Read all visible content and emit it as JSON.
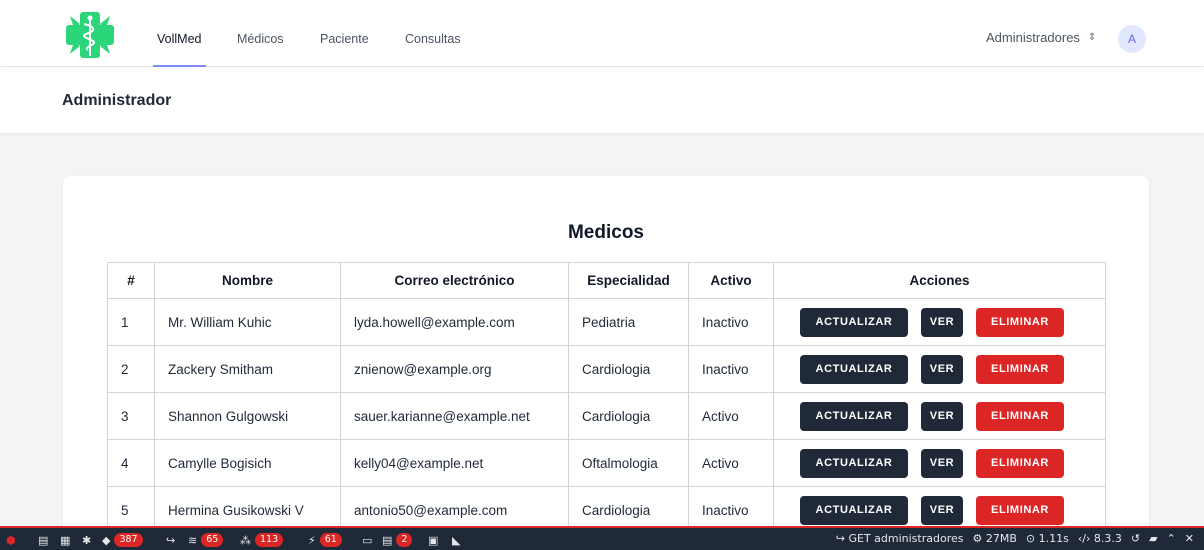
{
  "nav": {
    "brand_link": "VollMed",
    "links": [
      "Médicos",
      "Paciente",
      "Consultas"
    ],
    "user_menu": "Administradores",
    "avatar_initial": "A"
  },
  "header": {
    "title": "Administrador"
  },
  "card": {
    "title": "Medicos",
    "columns": [
      "#",
      "Nombre",
      "Correo electrónico",
      "Especialidad",
      "Activo",
      "Acciones"
    ],
    "rows": [
      {
        "id": "1",
        "name": "Mr. William Kuhic",
        "email": "lyda.howell@example.com",
        "specialty": "Pediatria",
        "active": "Inactivo"
      },
      {
        "id": "2",
        "name": "Zackery Smitham",
        "email": "znienow@example.org",
        "specialty": "Cardiologia",
        "active": "Inactivo"
      },
      {
        "id": "3",
        "name": "Shannon Gulgowski",
        "email": "sauer.karianne@example.net",
        "specialty": "Cardiologia",
        "active": "Activo"
      },
      {
        "id": "4",
        "name": "Camylle Bogisich",
        "email": "kelly04@example.net",
        "specialty": "Oftalmologia",
        "active": "Activo"
      },
      {
        "id": "5",
        "name": "Hermina Gusikowski V",
        "email": "antonio50@example.com",
        "specialty": "Cardiologia",
        "active": "Inactivo"
      }
    ],
    "actions": {
      "update": "ACTUALIZAR",
      "view": "VER",
      "delete": "ELIMINAR"
    }
  },
  "debugbar": {
    "badges": [
      "387",
      "65",
      "113",
      "61",
      "2"
    ],
    "request": "GET administradores",
    "memory": "27MB",
    "time": "1.11s",
    "php_version": "8.3.3"
  },
  "colors": {
    "accent": "#818cf8",
    "button_dark": "#1f2937",
    "button_danger": "#dc2626",
    "logo_green": "#2bd67b"
  },
  "icons": [
    "logo-caduceus-icon",
    "chevron-updown-icon",
    "laravel-icon",
    "share-icon",
    "database-icon",
    "gear-icon",
    "clock-icon",
    "code-icon",
    "history-icon",
    "folder-icon",
    "chevron-up-icon",
    "close-icon"
  ]
}
